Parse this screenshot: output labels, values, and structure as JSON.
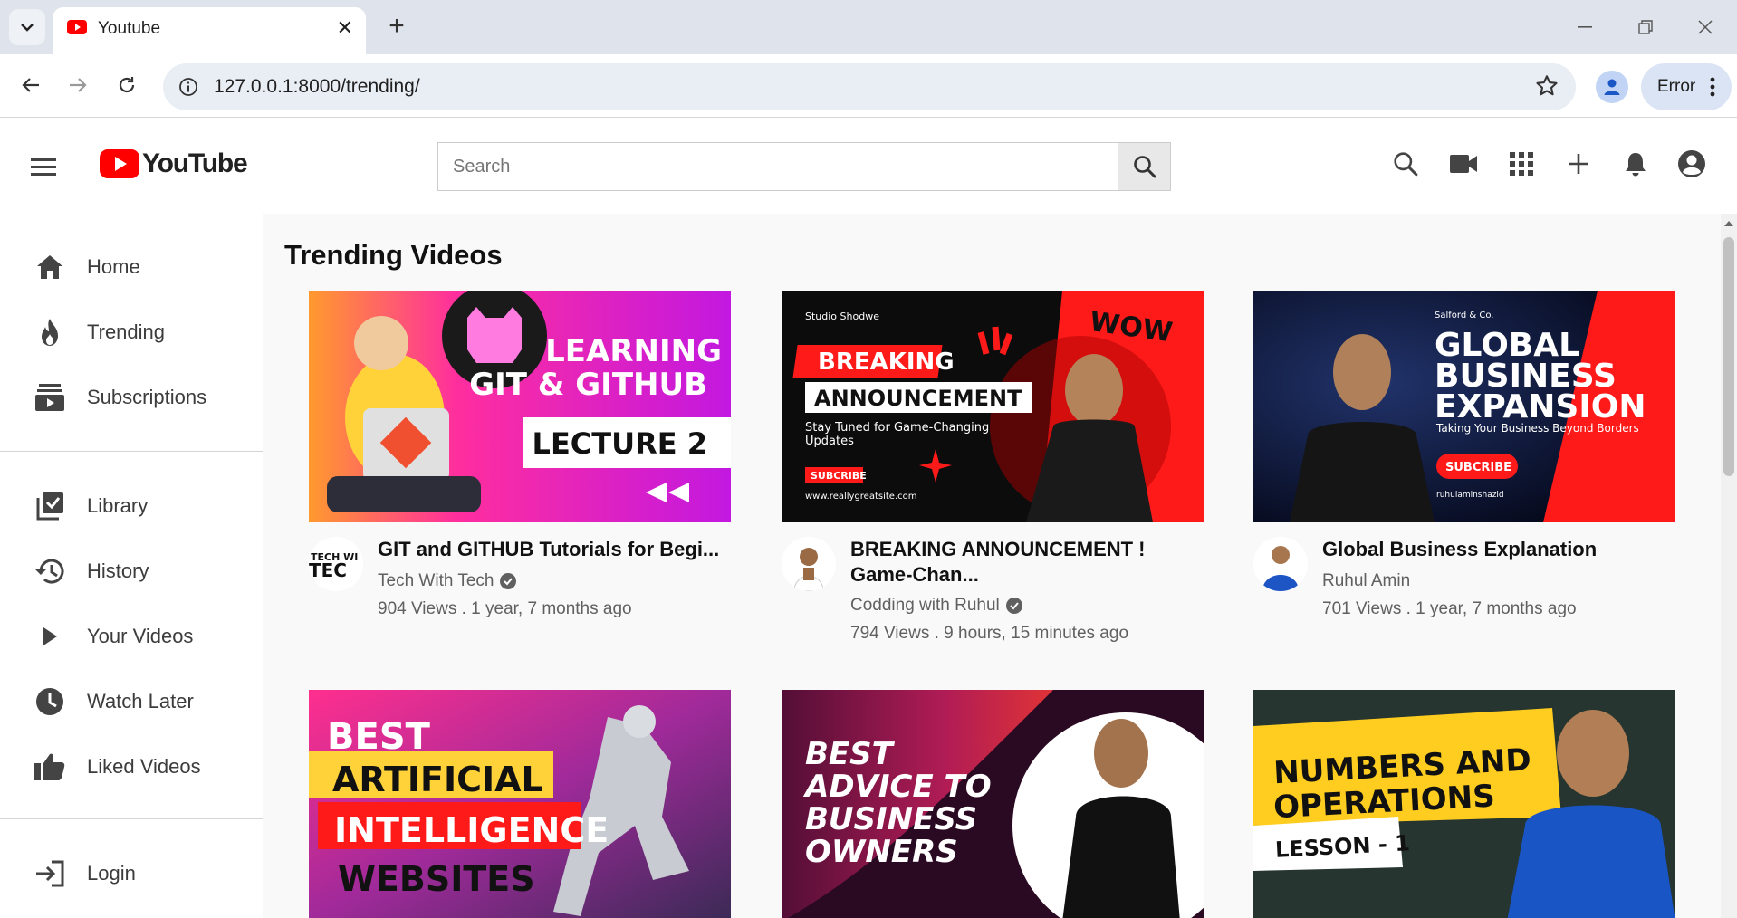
{
  "browser": {
    "tab_title": "Youtube",
    "url": "127.0.0.1:8000/trending/",
    "error_label": "Error"
  },
  "header": {
    "logo_text": "YouTube",
    "search_placeholder": "Search"
  },
  "sidebar": {
    "items": [
      {
        "label": "Home",
        "icon": "home-icon"
      },
      {
        "label": "Trending",
        "icon": "fire-icon"
      },
      {
        "label": "Subscriptions",
        "icon": "subscriptions-icon"
      },
      {
        "label": "Library",
        "icon": "library-icon"
      },
      {
        "label": "History",
        "icon": "history-icon"
      },
      {
        "label": "Your Videos",
        "icon": "play-icon"
      },
      {
        "label": "Watch Later",
        "icon": "clock-icon"
      },
      {
        "label": "Liked Videos",
        "icon": "thumbs-up-icon"
      },
      {
        "label": "Login",
        "icon": "login-icon"
      }
    ]
  },
  "main": {
    "title": "Trending Videos",
    "videos": [
      {
        "title": "GIT and GITHUB Tutorials for Begi...",
        "channel": "Tech With Tech",
        "verified": true,
        "meta": "904 Views . 1 year, 7 months ago",
        "thumb_lines": [
          "LEARNING",
          "GIT & GITHUB",
          "LECTURE 2"
        ],
        "avatar_text": "TECH WI TEC"
      },
      {
        "title": "BREAKING ANNOUNCEMENT ! Game-Chan...",
        "channel": "Codding with Ruhul",
        "verified": true,
        "meta": "794 Views . 9 hours, 15 minutes ago",
        "thumb_lines": [
          "Studio Shodwe",
          "BREAKING",
          "ANNOUNCEMENT",
          "Stay Tuned for Game-Changing",
          "Updates",
          "SUBCRIBE",
          "www.reallygreatsite.com",
          "WOW"
        ]
      },
      {
        "title": "Global Business Explanation",
        "channel": "Ruhul Amin",
        "verified": false,
        "meta": "701 Views . 1 year, 7 months ago",
        "thumb_lines": [
          "Salford & Co.",
          "GLOBAL",
          "BUSINESS",
          "EXPANSION",
          "Taking Your Business Beyond Borders",
          "SUBCRIBE",
          "ruhulaminshazid"
        ]
      },
      {
        "thumb_lines": [
          "BEST",
          "ARTIFICIAL",
          "INTELLIGENCE",
          "WEBSITES"
        ]
      },
      {
        "thumb_lines": [
          "BEST",
          "ADVICE TO",
          "BUSINESS",
          "OWNERS"
        ]
      },
      {
        "thumb_lines": [
          "NUMBERS AND",
          "OPERATIONS",
          "LESSON - 1"
        ]
      }
    ]
  },
  "colors": {
    "brand_red": "#ff0000",
    "verified_gray": "#606060"
  }
}
